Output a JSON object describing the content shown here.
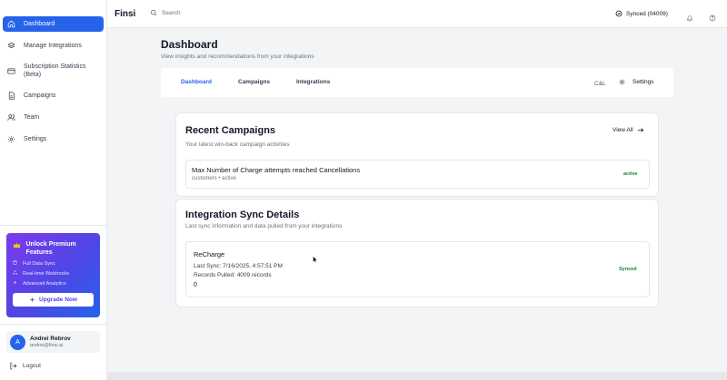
{
  "sidebar": {
    "items": [
      {
        "label": "Dashboard",
        "icon": "home-icon",
        "active": true
      },
      {
        "label": "Manage Integrations",
        "icon": "layers-icon"
      },
      {
        "label": "Subscription Statistics (Beta)",
        "icon": "credit-card-icon"
      },
      {
        "label": "Campaigns",
        "icon": "document-icon"
      },
      {
        "label": "Team",
        "icon": "users-icon"
      },
      {
        "label": "Settings",
        "icon": "gear-icon"
      }
    ],
    "premium": {
      "title": "Unlock Premium Features",
      "features": [
        {
          "label": "Full Data Sync",
          "icon": "database-icon"
        },
        {
          "label": "Real-time Webhooks",
          "icon": "webhook-icon"
        },
        {
          "label": "Advanced Analytics",
          "icon": "sparkle-icon"
        }
      ],
      "button": "Upgrade Now"
    },
    "user": {
      "initial": "A",
      "name": "Andrei Rebrov",
      "email": "andrei@finsi.ai"
    },
    "logout": "Logout"
  },
  "topbar": {
    "brand": "Finsi",
    "search_placeholder": "Search",
    "sync_status": "Synced (04009)"
  },
  "page": {
    "title": "Dashboard",
    "subtitle": "View insights and recommendations from your integrations"
  },
  "tabs": {
    "items": [
      "Dashboard",
      "Campaigns",
      "Integrations"
    ],
    "active": "Dashboard",
    "cnl": "C&L",
    "settings": "Settings"
  },
  "recent_campaigns": {
    "title": "Recent Campaigns",
    "subtitle": "Your latest win-back campaign activities",
    "view_all": "View All",
    "campaigns": [
      {
        "name": "Max Number of Charge attempts reached Cancellations",
        "meta": "customers • active",
        "status": "active"
      }
    ]
  },
  "integration_sync": {
    "title": "Integration Sync Details",
    "subtitle": "Last sync information and data pulled from your integrations",
    "integrations": [
      {
        "name": "ReCharge",
        "last_sync": "Last Sync: 7/16/2025, 4:57:51 PM",
        "records": "Records Pulled: 4009 records",
        "extra": "0",
        "status": "Synced"
      }
    ]
  },
  "colors": {
    "accent": "#2563eb",
    "success": "#15803d",
    "premium_from": "#7c3aed",
    "premium_to": "#2563eb"
  }
}
